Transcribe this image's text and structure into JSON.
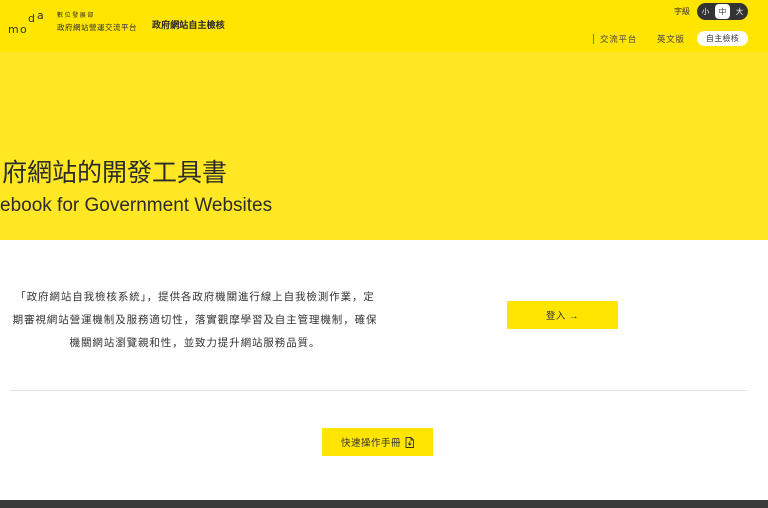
{
  "colors": {
    "brand_yellow": "#FFE500",
    "hero_yellow": "#FFE823",
    "text": "#333333",
    "footer": "#3A3A3A",
    "divider": "#E2E2E2"
  },
  "header": {
    "logo": {
      "letters": [
        "m",
        "o",
        "d",
        "a"
      ]
    },
    "org_ministry": "數位發展部",
    "org_platform": "政府網站營運交流平台",
    "site_title": "政府網站自主檢核",
    "font_size": {
      "label": "字級",
      "options": [
        {
          "label": "小",
          "selected": false
        },
        {
          "label": "中",
          "selected": true
        },
        {
          "label": "大",
          "selected": false
        }
      ]
    },
    "nav": [
      {
        "label": "交流平台",
        "active": false
      },
      {
        "label": "英文版",
        "active": false
      },
      {
        "label": "自主檢核",
        "active": true
      }
    ]
  },
  "hero": {
    "title": "府網站的開發工具書",
    "subtitle": "ebook for Government Websites"
  },
  "intro": {
    "lines": [
      "「政府網站自我檢核系統」，提供各政府機關進行線上自我檢測作業，定",
      "期審視網站營運機制及服務適切性，落實觀摩學習及自主管理機制，確保",
      "機關網站瀏覽親和性，並致力提升網站服務品質。"
    ]
  },
  "login_button": {
    "label": "登入 →"
  },
  "manual_button": {
    "label": "快速操作手冊",
    "icon": "file-download-icon"
  }
}
